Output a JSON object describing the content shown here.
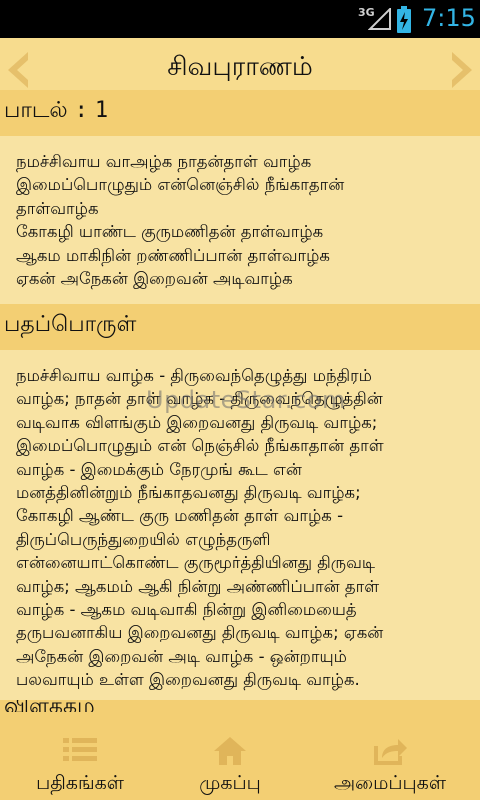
{
  "status": {
    "network": "3G",
    "time": "7:15"
  },
  "header": {
    "title": "சிவபுராணம்"
  },
  "song_section": {
    "label": "பாடல்",
    "separator": ":",
    "number": "1"
  },
  "verse_text": "நமச்சிவாய வாஅழ்க நாதன்தாள் வாழ்க\nஇமைப்பொழுதும் என்னெஞ்சில் நீங்காதான்\nதாள்வாழ்க\nகோகழி யாண்ட குருமணிதன் தாள்வாழ்க\nஆகம மாகிநின் றண்ணிப்பான் தாள்வாழ்க\nஏகன் அநேகன் இறைவன் அடிவாழ்க",
  "meaning_section": {
    "label": "பதப்பொருள்"
  },
  "meaning_text": "நமச்சிவாய வாழ்க - திருவைந்தெழுத்து மந்திரம்\nவாழ்க; நாதன் தாள் வாழ்க - திருவைந்தெழுத்தின்\nவடிவாக விளங்கும் இறைவனது திருவடி வாழ்க;\nஇமைப்பொழுதும் என் நெஞ்சில் நீங்காதான் தாள்\nவாழ்க - இமைக்கும் நேரமுங் கூட என்\nமனத்தினின்றும் நீங்காதவனது திருவடி வாழ்க;\nகோகழி ஆண்ட குரு மணிதன் தாள் வாழ்க -\nதிருப்பெருந்துறையில் எழுந்தருளி\nஎன்னையாட்கொண்ட குருமூர்த்தியினது திருவடி\nவாழ்க; ஆகமம் ஆகி நின்று அண்ணிப்பான் தாள்\nவாழ்க - ஆகம வடிவாகி நின்று இனிமையைத்\nதருபவனாகிய இறைவனது திருவடி வாழ்க; ஏகன்\nஅநேகன் இறைவன் அடி வாழ்க - ஒன்றாயும்\nபலவாயும் உள்ள இறைவனது திருவடி வாழ்க.",
  "next_section": {
    "label": "விளக்கம்"
  },
  "watermark": "UpdateStar.com",
  "bottom_nav": [
    {
      "label": "பதிகங்கள்",
      "icon": "list-icon"
    },
    {
      "label": "முகப்பு",
      "icon": "home-icon"
    },
    {
      "label": "அமைப்புகள்",
      "icon": "share-icon"
    }
  ],
  "colors": {
    "background": "#f8e3a3",
    "header_band": "#f3cf73",
    "icon_tint": "#e0b55a",
    "status_blue": "#33b5e5"
  }
}
